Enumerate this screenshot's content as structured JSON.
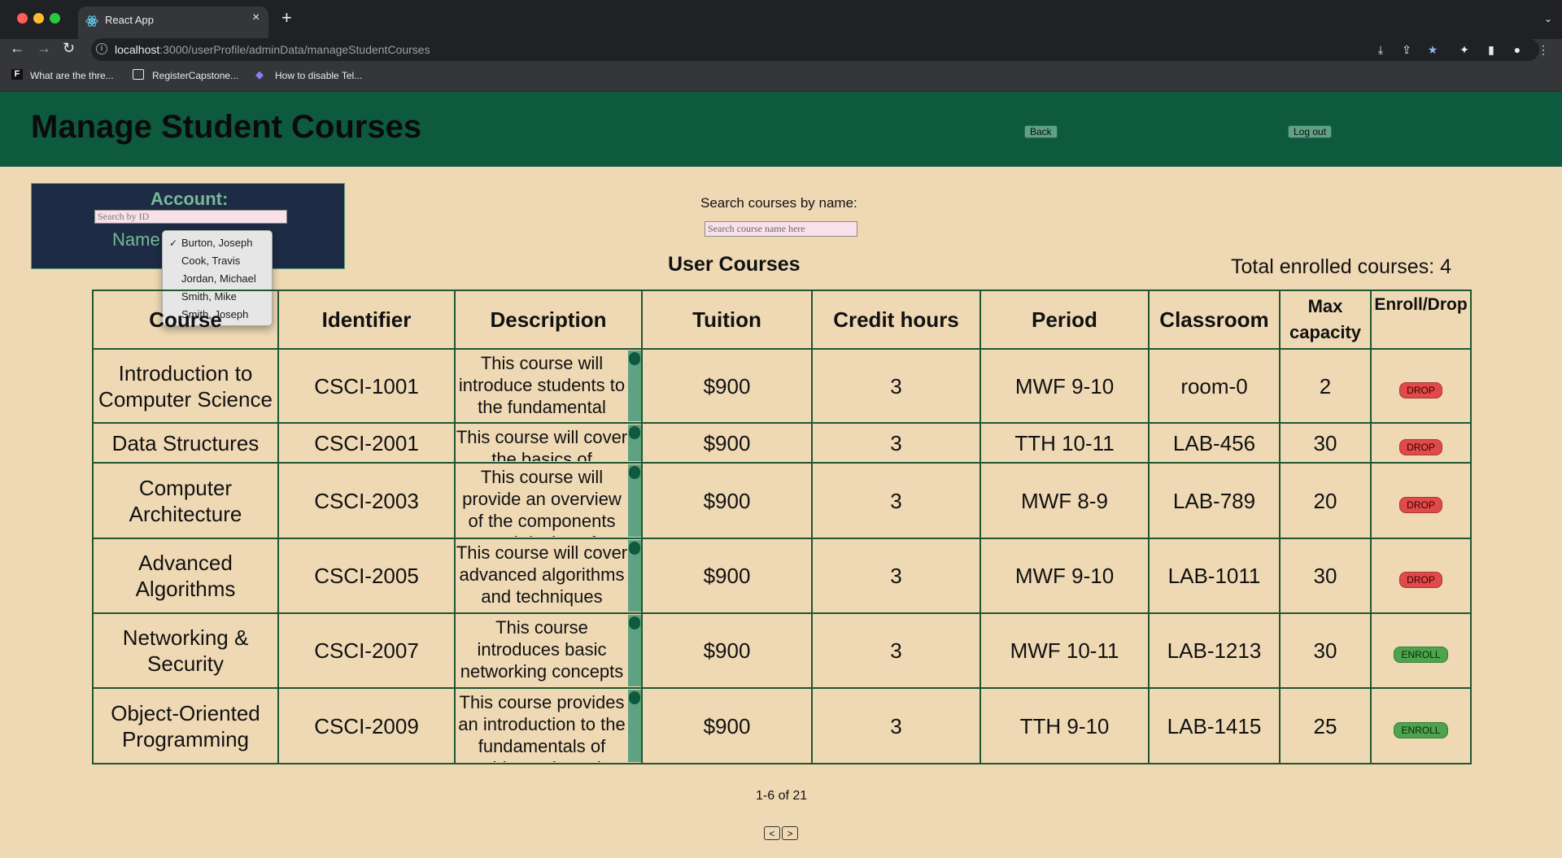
{
  "browser": {
    "tab_title": "React App",
    "url_host": "localhost",
    "url_rest": ":3000/userProfile/adminData/manageStudentCourses",
    "bookmarks": [
      "What are the thre...",
      "RegisterCapstone...",
      "How to disable Tel..."
    ]
  },
  "header": {
    "title": "Manage Student Courses",
    "back_label": "Back",
    "logout_label": "Log out"
  },
  "account": {
    "title": "Account:",
    "search_placeholder": "Search by ID",
    "name_label": "Name",
    "selected_name": "Burton, Joseph",
    "name_options": [
      "Burton, Joseph",
      "Cook, Travis",
      "Jordan, Michael",
      "Smith, Mike",
      "Smith, Joseph"
    ]
  },
  "search": {
    "label": "Search courses by name:",
    "placeholder": "Search course name here"
  },
  "courses": {
    "title": "User Courses",
    "total_label": "Total enrolled courses: 4",
    "columns": [
      "Course",
      "Identifier",
      "Description",
      "Tuition",
      "Credit hours",
      "Period",
      "Classroom",
      "Max capacity",
      "Enroll/Drop"
    ],
    "rows": [
      {
        "name": "Introduction to Computer Science",
        "id": "CSCI-1001",
        "description": "This course will introduce students to the fundamental concepts behind",
        "tuition": "$900",
        "credits": "3",
        "period": "MWF 9-10",
        "room": "room-0",
        "capacity": "2",
        "action": "DROP"
      },
      {
        "name": "Data Structures",
        "id": "CSCI-2001",
        "description": "This course will cover the basics of",
        "tuition": "$900",
        "credits": "3",
        "period": "TTH 10-11",
        "room": "LAB-456",
        "capacity": "30",
        "action": "DROP"
      },
      {
        "name": "Computer Architecture",
        "id": "CSCI-2003",
        "description": "This course will provide an overview of the components and design of",
        "tuition": "$900",
        "credits": "3",
        "period": "MWF 8-9",
        "room": "LAB-789",
        "capacity": "20",
        "action": "DROP"
      },
      {
        "name": "Advanced Algorithms",
        "id": "CSCI-2005",
        "description": "This course will cover advanced algorithms and techniques",
        "tuition": "$900",
        "credits": "3",
        "period": "MWF 9-10",
        "room": "LAB-1011",
        "capacity": "30",
        "action": "DROP"
      },
      {
        "name": "Networking & Security",
        "id": "CSCI-2007",
        "description": "This course introduces basic networking concepts and the principles",
        "tuition": "$900",
        "credits": "3",
        "period": "MWF 10-11",
        "room": "LAB-1213",
        "capacity": "30",
        "action": "ENROLL"
      },
      {
        "name": "Object-Oriented Programming",
        "id": "CSCI-2009",
        "description": "This course provides an introduction to the fundamentals of object-oriented",
        "tuition": "$900",
        "credits": "3",
        "period": "TTH 9-10",
        "room": "LAB-1415",
        "capacity": "25",
        "action": "ENROLL"
      }
    ]
  },
  "pagination": {
    "label": "1-6 of 21",
    "prev_label": "<",
    "next_label": ">"
  },
  "colors": {
    "header_green": "#0e5a3e",
    "page_bg": "#efd9b4",
    "panel_navy": "#1d2c44",
    "drop_red": "#e04a4a",
    "enroll_green": "#4ea34e"
  }
}
